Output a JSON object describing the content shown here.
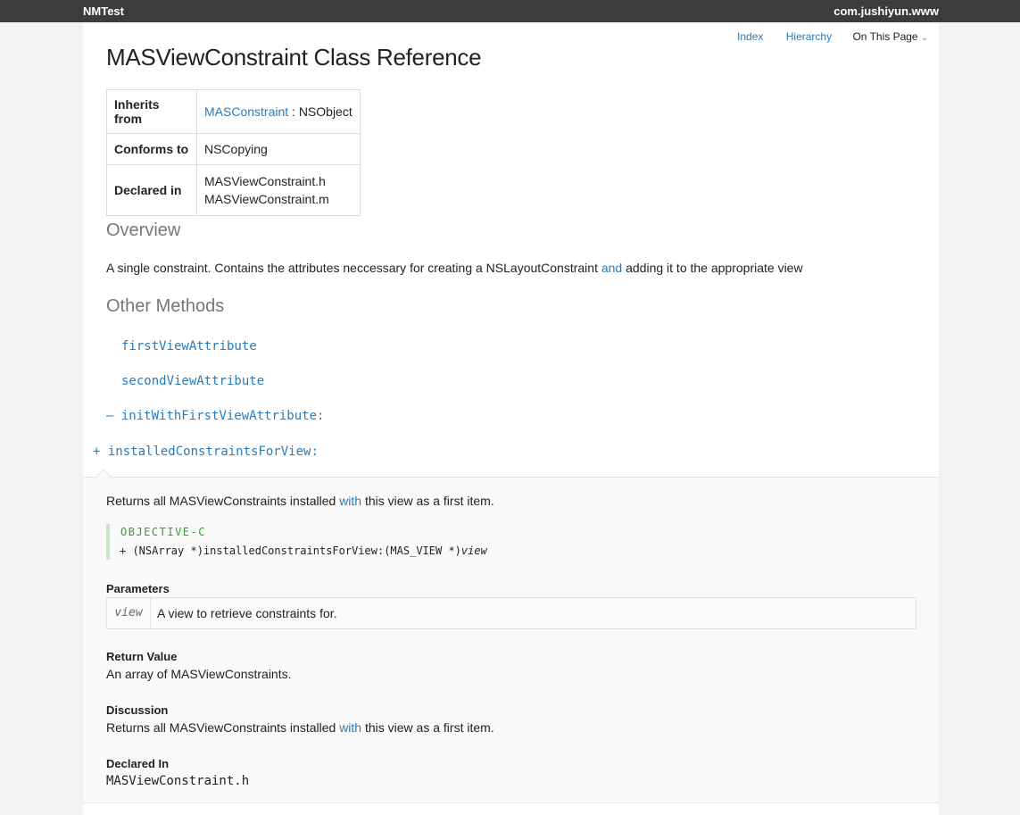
{
  "topbar": {
    "left_title": "NMTest",
    "right_title": "com.jushiyun.www"
  },
  "nav": {
    "index": "Index",
    "hierarchy": "Hierarchy",
    "on_this_page": "On This Page"
  },
  "page_title": "MASViewConstraint Class Reference",
  "info_table": {
    "inherits_label": "Inherits from",
    "inherits_link": "MASConstraint",
    "inherits_rest": " : NSObject",
    "conforms_label": "Conforms to",
    "conforms_value": "NSCopying",
    "declared_label": "Declared in",
    "declared_values": [
      "MASViewConstraint.h",
      "MASViewConstraint.m"
    ]
  },
  "overview": {
    "heading": "Overview",
    "text_before": "A single constraint. Contains the attributes neccessary for creating a NSLayoutConstraint ",
    "text_link": "and",
    "text_after": " adding it to the appropriate view"
  },
  "other_methods": {
    "heading": "Other Methods",
    "methods": [
      {
        "symbol": "",
        "name": "firstViewAttribute"
      },
      {
        "symbol": "",
        "name": "secondViewAttribute"
      },
      {
        "symbol": "–",
        "name": "initWithFirstViewAttribute:"
      },
      {
        "symbol": "+",
        "name": "installedConstraintsForView:"
      }
    ]
  },
  "detail": {
    "summary_before": "Returns all MASViewConstraints installed ",
    "summary_link": "with",
    "summary_after": " this view as a first item.",
    "code_language": "OBJECTIVE-C",
    "code_prefix": "+ (NSArray *)installedConstraintsForView:(MAS_VIEW *)",
    "code_param": "view",
    "parameters_heading": "Parameters",
    "param_name": "view",
    "param_desc": "A view to retrieve constraints for.",
    "return_heading": "Return Value",
    "return_text": "An array of MASViewConstraints.",
    "discussion_heading": "Discussion",
    "discussion_before": "Returns all MASViewConstraints installed ",
    "discussion_link": "with",
    "discussion_after": " this view as a first item.",
    "declared_heading": "Declared In",
    "declared_value": "MASViewConstraint.h"
  }
}
